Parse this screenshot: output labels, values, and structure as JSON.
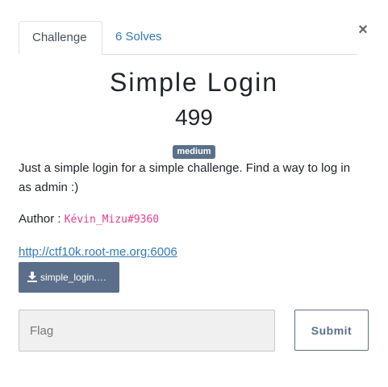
{
  "modal": {
    "close_label": "×",
    "tabs": [
      {
        "label": "Challenge"
      },
      {
        "label": "6 Solves"
      }
    ],
    "title": "Simple Login",
    "points": "499",
    "difficulty_badge": "medium",
    "description": "Just a simple login for a simple challenge. Find a way to log in as admin :)",
    "author_label": "Author : ",
    "author_handle": "Kévin_Mizu#9360",
    "link": "http://ctf10k.root-me.org:6006",
    "file_button_label": "simple_login.…",
    "flag_placeholder": "Flag",
    "submit_label": "Submit"
  },
  "colors": {
    "accent": "#5b6f8a",
    "link": "#337ab7",
    "author_handle": "#e83e8c"
  },
  "icons": {
    "close": "close-icon",
    "download": "download-icon"
  }
}
